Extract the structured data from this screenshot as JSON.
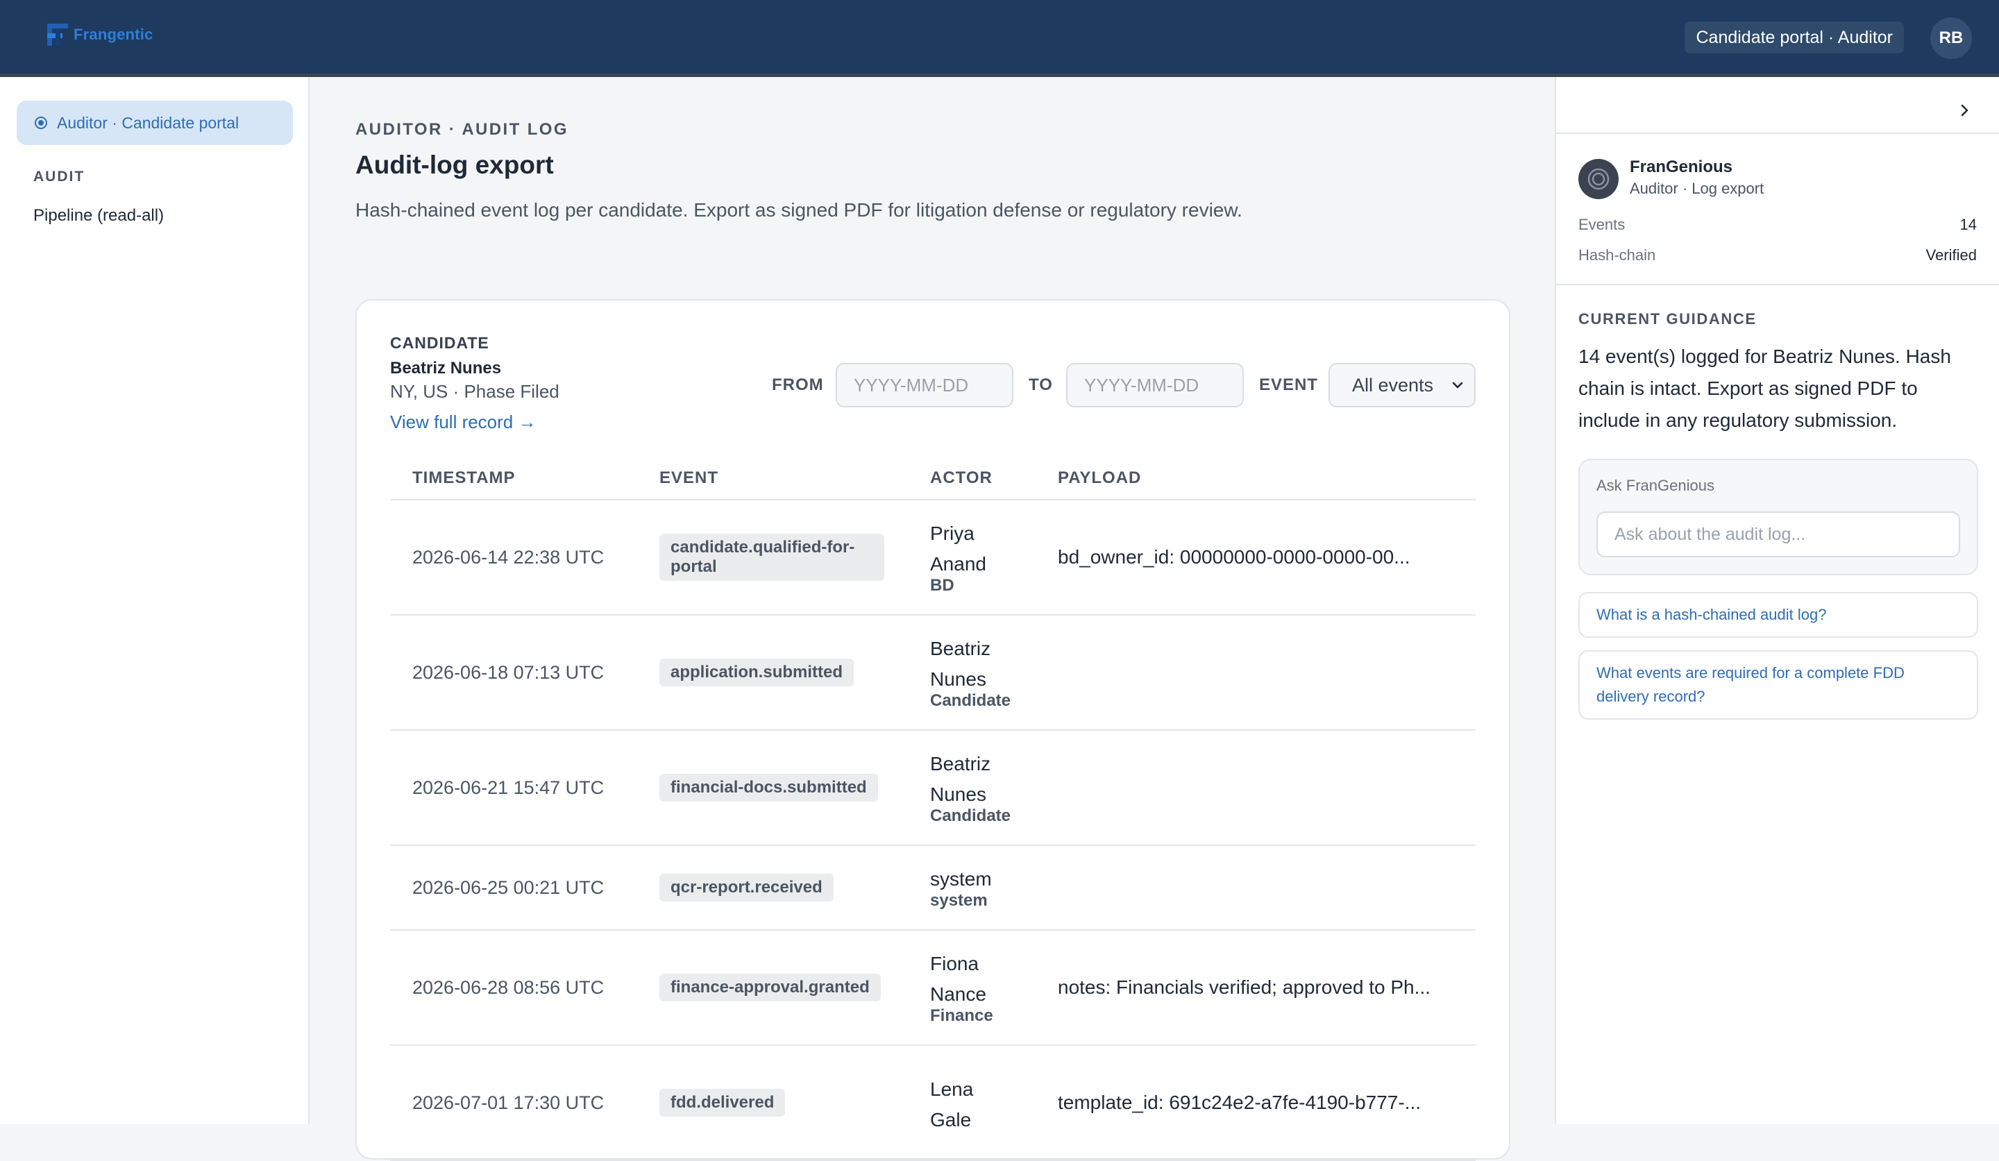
{
  "header": {
    "brand_name": "Frangentic",
    "role_label": "Candidate portal · Auditor",
    "user_initials": "RB"
  },
  "sidebar": {
    "context_label": "Auditor · Candidate portal",
    "section_label": "AUDIT",
    "items": [
      {
        "label": "Pipeline (read-all)"
      }
    ]
  },
  "main": {
    "eyebrow": "AUDITOR · AUDIT LOG",
    "title": "Audit-log export",
    "description": "Hash-chained event log per candidate. Export as signed PDF for litigation defense or regulatory review."
  },
  "candidate": {
    "label": "CANDIDATE",
    "name": "Beatriz Nunes",
    "location": "NY, US · Phase Filed",
    "link_label": "View full record →"
  },
  "filters": {
    "from_label": "FROM",
    "from_placeholder": "YYYY-MM-DD",
    "to_label": "TO",
    "to_placeholder": "YYYY-MM-DD",
    "event_label": "EVENT",
    "event_selected": "All events"
  },
  "table": {
    "columns": [
      "TIMESTAMP",
      "EVENT",
      "ACTOR",
      "PAYLOAD"
    ],
    "rows": [
      {
        "timestamp": "2026-06-14 22:38 UTC",
        "event": "candidate.qualified-for-portal",
        "actor_name": "Priya Anand",
        "actor_role": "BD",
        "payload": "bd_owner_id: 00000000-0000-0000-00..."
      },
      {
        "timestamp": "2026-06-18 07:13 UTC",
        "event": "application.submitted",
        "actor_name": "Beatriz Nunes",
        "actor_role": "Candidate",
        "payload": ""
      },
      {
        "timestamp": "2026-06-21 15:47 UTC",
        "event": "financial-docs.submitted",
        "actor_name": "Beatriz Nunes",
        "actor_role": "Candidate",
        "payload": ""
      },
      {
        "timestamp": "2026-06-25 00:21 UTC",
        "event": "qcr-report.received",
        "actor_name": "system",
        "actor_role": "system",
        "payload": ""
      },
      {
        "timestamp": "2026-06-28 08:56 UTC",
        "event": "finance-approval.granted",
        "actor_name": "Fiona Nance",
        "actor_role": "Finance",
        "payload": "notes: Financials verified; approved to Ph..."
      },
      {
        "timestamp": "2026-07-01 17:30 UTC",
        "event": "fdd.delivered",
        "actor_name": "Lena Gale",
        "actor_role": "",
        "payload": "template_id: 691c24e2-a7fe-4190-b777-..."
      }
    ]
  },
  "panel": {
    "assistant_name": "FranGenious",
    "assistant_sub": "Auditor · Log export",
    "stats": [
      {
        "label": "Events",
        "value": "14"
      },
      {
        "label": "Hash-chain",
        "value": "Verified"
      }
    ],
    "guidance_title": "CURRENT GUIDANCE",
    "guidance_text": "14 event(s) logged for Beatriz Nunes. Hash chain is intact. Export as signed PDF to include in any regulatory submission.",
    "ask_label": "Ask FranGenious",
    "ask_placeholder": "Ask about the audit log...",
    "suggestions": [
      "What is a hash-chained audit log?",
      "What events are required for a complete FDD delivery record?"
    ]
  },
  "icons": {
    "brand": "brand-logo-icon",
    "context": "radio-dot-icon",
    "collapse": "chevron-right-icon",
    "select": "chevron-down-icon",
    "assistant": "assistant-orb-icon"
  },
  "colors": {
    "header_bg": "#1e3a5f",
    "accent": "#2e6db4",
    "context_pill": "#d6e6f6"
  }
}
